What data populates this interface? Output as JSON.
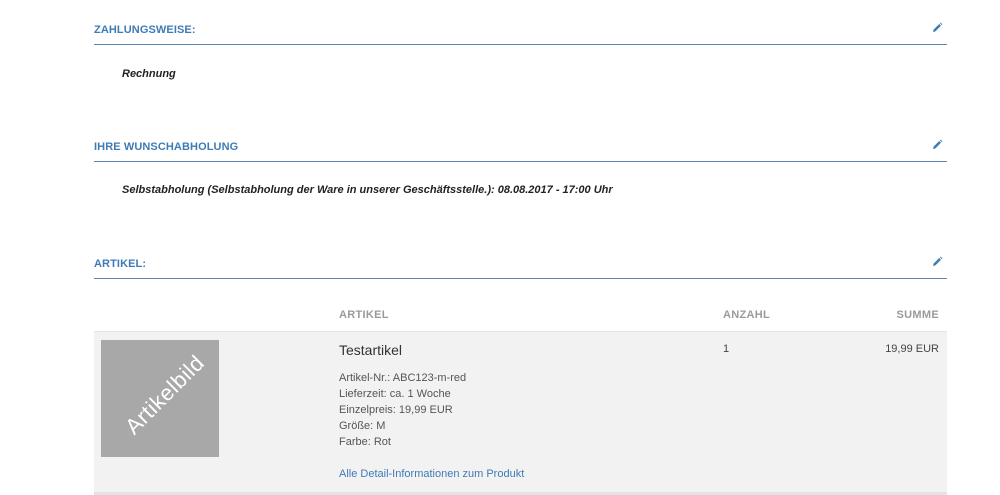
{
  "payment": {
    "title": "ZAHLUNGSWEISE:",
    "value": "Rechnung"
  },
  "pickup": {
    "title": "IHRE WUNSCHABHOLUNG",
    "value": "Selbstabholung (Selbstabholung der Ware in unserer Geschäftsstelle.): 08.08.2017 - 17:00 Uhr"
  },
  "articles": {
    "title": "ARTIKEL:",
    "columns": {
      "article": "ARTIKEL",
      "quantity": "ANZAHL",
      "sum": "SUMME"
    },
    "items": [
      {
        "image_label": "Artikelbild",
        "name": "Testartikel",
        "article_no": "Artikel-Nr.: ABC123-m-red",
        "delivery": "Lieferzeit: ca. 1 Woche",
        "unit_price": "Einzelpreis: 19,99 EUR",
        "size": "Größe: M",
        "color": "Farbe: Rot",
        "detail_link": "Alle Detail-Informationen zum Produkt",
        "quantity": "1",
        "sum": "19,99 EUR"
      }
    ]
  },
  "icons": {
    "edit": "pencil-icon"
  },
  "colors": {
    "accent": "#3f7bb6",
    "thumb_bg": "#a8a8a8",
    "row_bg": "#f2f2f2"
  }
}
